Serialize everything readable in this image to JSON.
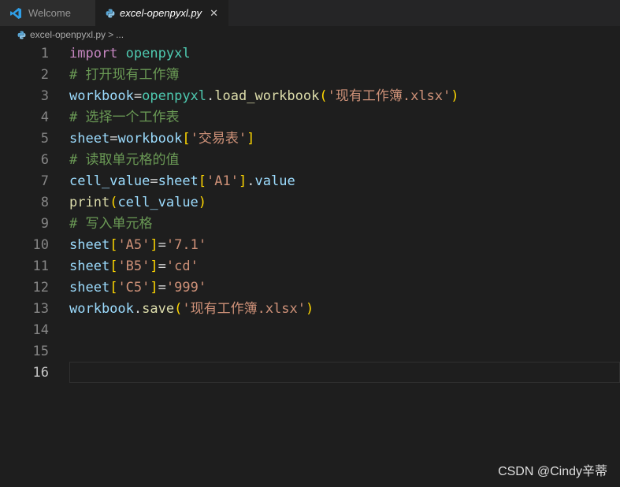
{
  "tabs": [
    {
      "label": "Welcome",
      "icon": "vscode-icon"
    },
    {
      "label": "excel-openpyxl.py",
      "icon": "python-icon",
      "close": "✕"
    }
  ],
  "breadcrumb": {
    "file": "excel-openpyxl.py",
    "separator": ">",
    "rest": "..."
  },
  "editor": {
    "line_numbers": [
      "1",
      "2",
      "3",
      "4",
      "5",
      "6",
      "7",
      "8",
      "9",
      "10",
      "11",
      "12",
      "13",
      "14",
      "15",
      "16"
    ],
    "active_line": "16",
    "lines": [
      [
        {
          "t": "import",
          "k": "kw"
        },
        {
          "t": " ",
          "k": "op"
        },
        {
          "t": "openpyxl",
          "k": "mod"
        }
      ],
      [
        {
          "t": "# 打开现有工作簿",
          "k": "cm"
        }
      ],
      [
        {
          "t": "workbook",
          "k": "var"
        },
        {
          "t": "=",
          "k": "op"
        },
        {
          "t": "openpyxl",
          "k": "mod"
        },
        {
          "t": ".",
          "k": "op"
        },
        {
          "t": "load_workbook",
          "k": "fn"
        },
        {
          "t": "(",
          "k": "br1"
        },
        {
          "t": "'现有工作簿.xlsx'",
          "k": "str"
        },
        {
          "t": ")",
          "k": "br1"
        }
      ],
      [
        {
          "t": "# 选择一个工作表",
          "k": "cm"
        }
      ],
      [
        {
          "t": "sheet",
          "k": "var"
        },
        {
          "t": "=",
          "k": "op"
        },
        {
          "t": "workbook",
          "k": "var"
        },
        {
          "t": "[",
          "k": "br1"
        },
        {
          "t": "'交易表'",
          "k": "str"
        },
        {
          "t": "]",
          "k": "br1"
        }
      ],
      [
        {
          "t": "# 读取单元格的值",
          "k": "cm"
        }
      ],
      [
        {
          "t": "cell_value",
          "k": "var"
        },
        {
          "t": "=",
          "k": "op"
        },
        {
          "t": "sheet",
          "k": "var"
        },
        {
          "t": "[",
          "k": "br1"
        },
        {
          "t": "'A1'",
          "k": "str"
        },
        {
          "t": "]",
          "k": "br1"
        },
        {
          "t": ".",
          "k": "op"
        },
        {
          "t": "value",
          "k": "var"
        }
      ],
      [
        {
          "t": "print",
          "k": "fn"
        },
        {
          "t": "(",
          "k": "br1"
        },
        {
          "t": "cell_value",
          "k": "var"
        },
        {
          "t": ")",
          "k": "br1"
        }
      ],
      [
        {
          "t": "# 写入单元格",
          "k": "cm"
        }
      ],
      [
        {
          "t": "sheet",
          "k": "var"
        },
        {
          "t": "[",
          "k": "br1"
        },
        {
          "t": "'A5'",
          "k": "str"
        },
        {
          "t": "]",
          "k": "br1"
        },
        {
          "t": "=",
          "k": "op"
        },
        {
          "t": "'7.1'",
          "k": "str"
        }
      ],
      [
        {
          "t": "sheet",
          "k": "var"
        },
        {
          "t": "[",
          "k": "br1"
        },
        {
          "t": "'B5'",
          "k": "str"
        },
        {
          "t": "]",
          "k": "br1"
        },
        {
          "t": "=",
          "k": "op"
        },
        {
          "t": "'cd'",
          "k": "str"
        }
      ],
      [
        {
          "t": "sheet",
          "k": "var"
        },
        {
          "t": "[",
          "k": "br1"
        },
        {
          "t": "'C5'",
          "k": "str"
        },
        {
          "t": "]",
          "k": "br1"
        },
        {
          "t": "=",
          "k": "op"
        },
        {
          "t": "'999'",
          "k": "str"
        }
      ],
      [
        {
          "t": "workbook",
          "k": "var"
        },
        {
          "t": ".",
          "k": "op"
        },
        {
          "t": "save",
          "k": "fn"
        },
        {
          "t": "(",
          "k": "br1"
        },
        {
          "t": "'现有工作簿.xlsx'",
          "k": "str"
        },
        {
          "t": ")",
          "k": "br1"
        }
      ],
      [],
      [],
      []
    ]
  },
  "watermark": "CSDN @Cindy辛蒂",
  "colors": {
    "background": "#1e1e1e",
    "keyword": "#c586c0",
    "module": "#4ec9b0",
    "comment": "#6a9955",
    "variable": "#9cdcfe",
    "function": "#dcdcaa",
    "string": "#ce9178",
    "bracket": "#ffd700"
  }
}
